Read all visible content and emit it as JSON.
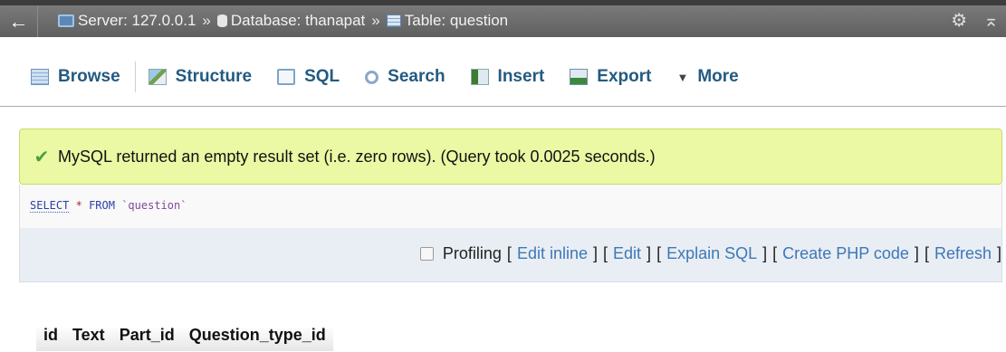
{
  "topbar": {
    "back_icon": "←",
    "crumbs": [
      {
        "icon": "server-icon",
        "label": "Server: 127.0.0.1"
      },
      {
        "icon": "database-icon",
        "label": "Database: thanapat"
      },
      {
        "icon": "table-icon",
        "label": "Table: question"
      }
    ],
    "separator": "»",
    "right_icons": [
      "gear-icon",
      "collapse-icon"
    ]
  },
  "tabs": [
    {
      "label": "Browse",
      "icon": "browse-icon",
      "active": true
    },
    {
      "label": "Structure",
      "icon": "structure-icon"
    },
    {
      "label": "SQL",
      "icon": "sql-icon"
    },
    {
      "label": "Search",
      "icon": "search-icon"
    },
    {
      "label": "Insert",
      "icon": "insert-icon"
    },
    {
      "label": "Export",
      "icon": "export-icon"
    },
    {
      "label": "More",
      "icon": "caret-down-icon"
    }
  ],
  "message": {
    "text": "MySQL returned an empty result set (i.e. zero rows). (Query took 0.0025 seconds.)",
    "icon": "check-icon",
    "background": "#ebf8a4"
  },
  "query": {
    "select": "SELECT",
    "op": "*",
    "from": "FROM",
    "ident": "`question`"
  },
  "actions": {
    "profiling": "Profiling",
    "edit_inline": "Edit inline",
    "edit": "Edit",
    "explain": "Explain SQL",
    "create_php": "Create PHP code",
    "refresh": "Refresh"
  },
  "columns": [
    "id",
    "Text",
    "Part_id",
    "Question_type_id"
  ]
}
